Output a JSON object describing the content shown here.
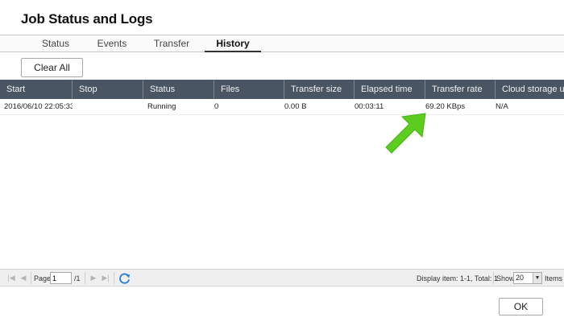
{
  "window": {
    "title": "Job Status and Logs"
  },
  "tabs": [
    {
      "label": "Status",
      "active": false
    },
    {
      "label": "Events",
      "active": false
    },
    {
      "label": "Transfer",
      "active": false
    },
    {
      "label": "History",
      "active": true
    }
  ],
  "toolbar": {
    "clear_all_label": "Clear All"
  },
  "grid": {
    "columns": [
      "Start",
      "Stop",
      "Status",
      "Files",
      "Transfer size",
      "Elapsed time",
      "Transfer rate",
      "Cloud storage us..."
    ],
    "rows": [
      [
        "2016/06/10 22:05:33",
        "",
        "Running",
        "0",
        "0.00 B",
        "00:03:11",
        "69.20 KBps",
        "N/A"
      ]
    ]
  },
  "pager": {
    "page_label": "Page",
    "page_value": "1",
    "page_total": "/1",
    "display_info": "Display item: 1-1, Total: 1",
    "show_label": "Show",
    "show_value": "20",
    "items_label": "Items"
  },
  "footer": {
    "ok_label": "OK"
  },
  "colors": {
    "header_bg": "#4a5563",
    "annotation_arrow": "#5ccc1f"
  },
  "icons": [
    "first-page-icon",
    "prev-page-icon",
    "next-page-icon",
    "last-page-icon",
    "refresh-icon",
    "dropdown-arrow-icon",
    "annotation-arrow-icon"
  ]
}
